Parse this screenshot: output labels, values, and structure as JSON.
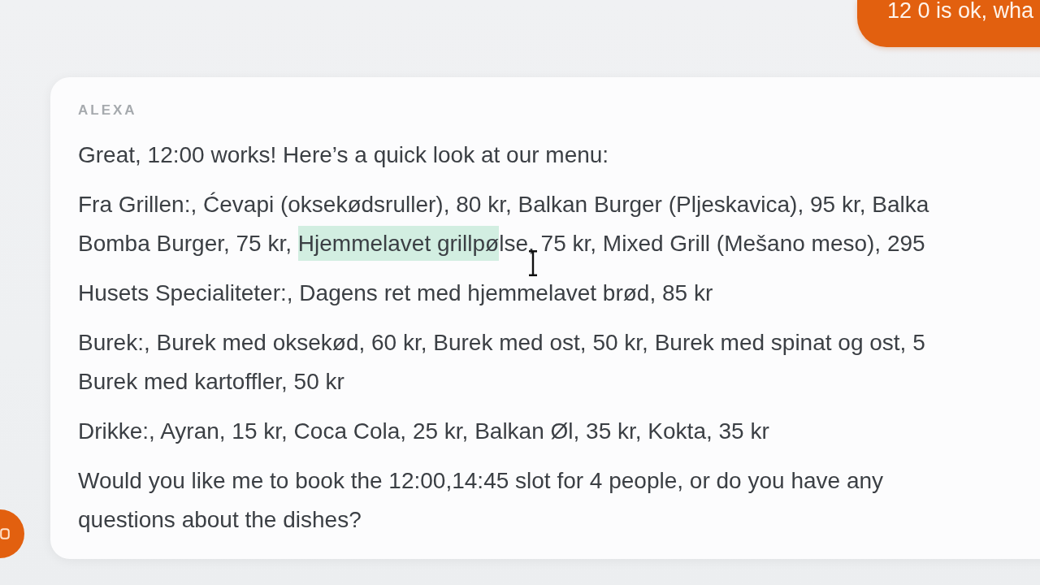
{
  "user_message": {
    "text": "12 0 is ok, wha"
  },
  "assistant_message": {
    "sender": "ALEXA",
    "paragraphs": [
      {
        "lines": [
          [
            {
              "text": "Great, 12:00 works! Here’s a quick look at our menu:",
              "selected": false
            }
          ]
        ]
      },
      {
        "lines": [
          [
            {
              "text": "Fra Grillen:, Ćevapi (oksekødsruller), 80 kr, Balkan Burger (Pljeskavica), 95 kr, Balka",
              "selected": false
            }
          ],
          [
            {
              "text": "Bomba Burger, 75 kr, ",
              "selected": false
            },
            {
              "text": "Hjemmelavet grillpø",
              "selected": true
            },
            {
              "text": "lse, 75 kr, Mixed Grill (Mešano meso), 295",
              "selected": false
            }
          ]
        ]
      },
      {
        "lines": [
          [
            {
              "text": "Husets Specialiteter:, Dagens ret med hjemmelavet brød, 85 kr",
              "selected": false
            }
          ]
        ]
      },
      {
        "lines": [
          [
            {
              "text": "Burek:, Burek med oksekød, 60 kr, Burek med ost, 50 kr, Burek med spinat og ost, 5",
              "selected": false
            }
          ],
          [
            {
              "text": "Burek med kartoffler, 50 kr",
              "selected": false
            }
          ]
        ]
      },
      {
        "lines": [
          [
            {
              "text": "Drikke:, Ayran, 15 kr, Coca Cola, 25 kr, Balkan Øl, 35 kr, Kokta, 35 kr",
              "selected": false
            }
          ]
        ]
      },
      {
        "lines": [
          [
            {
              "text": "Would you like me to book the 12:00,14:45 slot for 4 people, or do you have any",
              "selected": false
            }
          ],
          [
            {
              "text": "questions about the dishes?",
              "selected": false
            }
          ]
        ]
      }
    ]
  }
}
